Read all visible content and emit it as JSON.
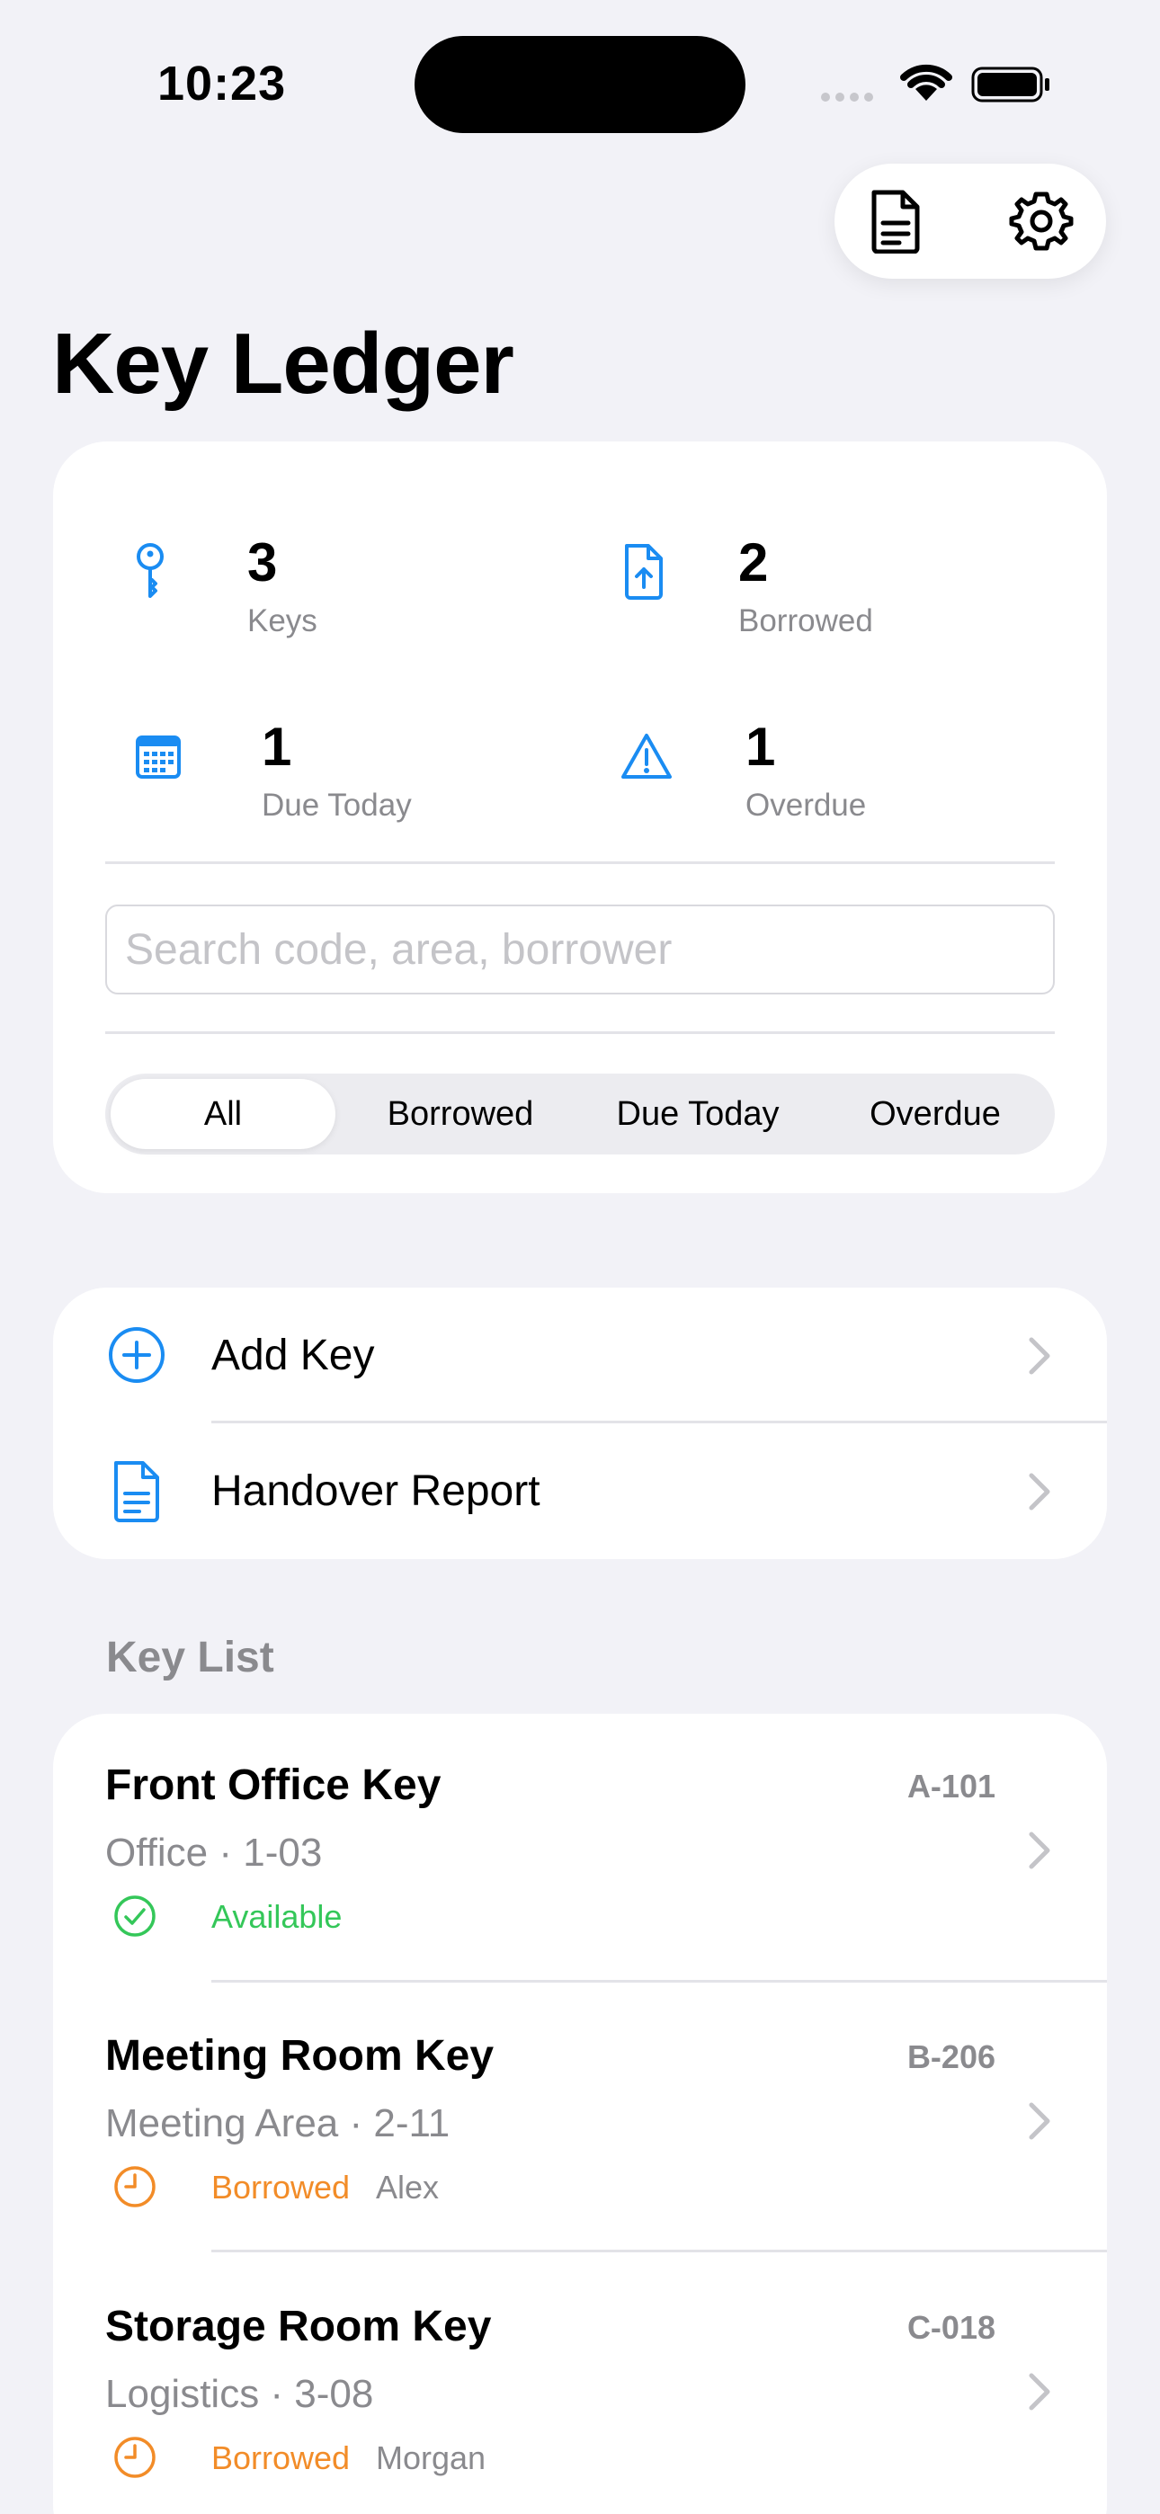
{
  "status_bar": {
    "time": "10:23"
  },
  "header": {
    "title": "Key Ledger"
  },
  "colors": {
    "accent": "#1a8cf2",
    "available": "#34c759",
    "borrowed": "#f28c28",
    "secondary_text": "#8a8a8e",
    "background": "#f2f2f7"
  },
  "stats": [
    {
      "value": "3",
      "label": "Keys",
      "icon": "key-icon"
    },
    {
      "value": "2",
      "label": "Borrowed",
      "icon": "doc-upload-icon"
    },
    {
      "value": "1",
      "label": "Due Today",
      "icon": "calendar-icon"
    },
    {
      "value": "1",
      "label": "Overdue",
      "icon": "warning-icon"
    }
  ],
  "search": {
    "placeholder": "Search code, area, borrower",
    "value": ""
  },
  "filters": {
    "selected": "All",
    "options": [
      "All",
      "Borrowed",
      "Due Today",
      "Overdue"
    ]
  },
  "actions": [
    {
      "label": "Add Key",
      "icon": "plus-circle-icon"
    },
    {
      "label": "Handover Report",
      "icon": "document-icon"
    }
  ],
  "key_list": {
    "title": "Key List",
    "items": [
      {
        "name": "Front Office Key",
        "code": "A-101",
        "meta": "Office · 1-03",
        "status": "Available",
        "borrower": ""
      },
      {
        "name": "Meeting Room Key",
        "code": "B-206",
        "meta": "Meeting Area · 2-11",
        "status": "Borrowed",
        "borrower": "Alex"
      },
      {
        "name": "Storage Room Key",
        "code": "C-018",
        "meta": "Logistics · 3-08",
        "status": "Borrowed",
        "borrower": "Morgan"
      }
    ]
  }
}
